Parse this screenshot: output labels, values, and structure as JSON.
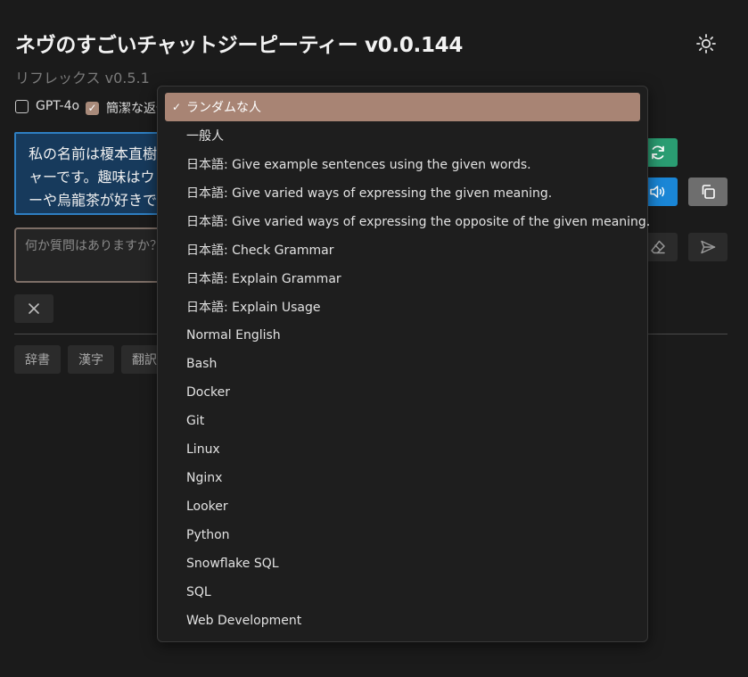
{
  "header": {
    "title": "ネヴのすごいチャットジーピーティー v0.0.144",
    "subtitle": "リフレックス v0.5.1"
  },
  "options": {
    "gpt4o_label": "GPT-4o",
    "gpt4o_checked": false,
    "concise_label": "簡潔な返信",
    "concise_checked": true
  },
  "assistant_message": {
    "lines": [
      "私の名前は榎本直樹",
      "ャーです。趣味はウ",
      "ーや烏龍茶が好きで"
    ]
  },
  "question_input": {
    "placeholder": "何か質問はありますか？"
  },
  "tags": [
    "辞書",
    "漢字",
    "翻訳"
  ],
  "check_mark": "✓",
  "persona_dropdown": {
    "selected": "ランダムな人",
    "items": [
      "ランダムな人",
      "一般人",
      "日本語: Give example sentences using the given words.",
      "日本語: Give varied ways of expressing the given meaning.",
      "日本語: Give varied ways of expressing the opposite of the given meaning.",
      "日本語: Check Grammar",
      "日本語: Explain Grammar",
      "日本語: Explain Usage",
      "Normal English",
      "Bash",
      "Docker",
      "Git",
      "Linux",
      "Nginx",
      "Looker",
      "Python",
      "Snowflake SQL",
      "SQL",
      "Web Development"
    ]
  },
  "icons": {
    "theme": "sun-icon",
    "regenerate": "refresh-icon",
    "speak": "speaker-icon",
    "copy": "copy-icon",
    "clear": "eraser-icon",
    "send": "send-icon",
    "close": "close-icon"
  },
  "colors": {
    "background": "#1b1b1b",
    "accent": "#a88474",
    "message_bg": "#173a5c",
    "message_border": "#2e7fc2",
    "regenerate_button": "#2a9d72",
    "speak_button": "#1a86d6"
  }
}
